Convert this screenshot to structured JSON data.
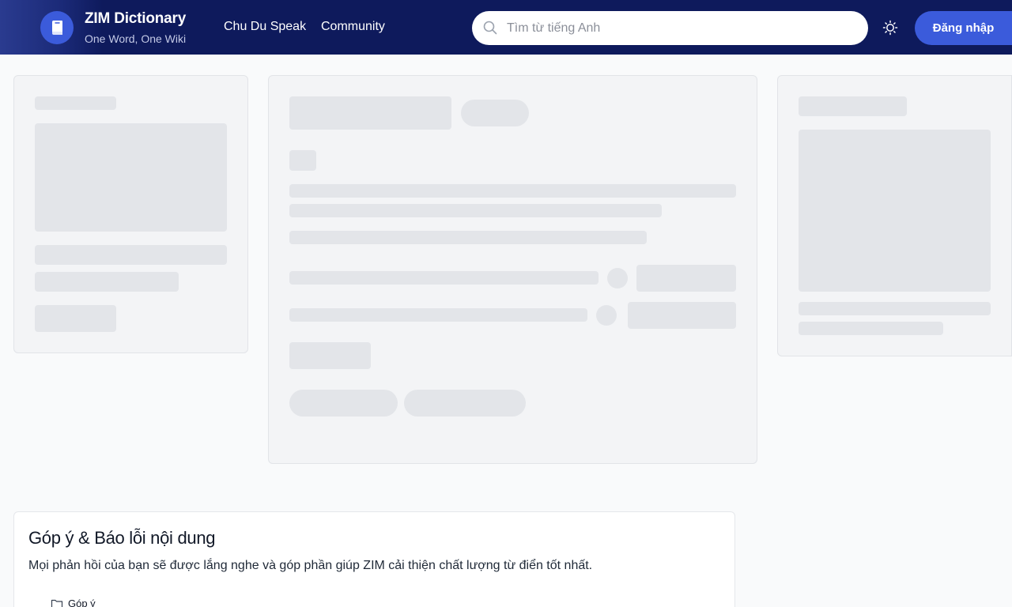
{
  "header": {
    "brand_title": "ZIM Dictionary",
    "brand_subtitle": "One Word, One Wiki",
    "nav": [
      {
        "label": "Chu Du Speak"
      },
      {
        "label": "Community"
      }
    ],
    "search": {
      "placeholder": "Tìm từ tiếng Anh",
      "value": ""
    },
    "login_label": "Đăng nhập",
    "icons": {
      "logo": "book-icon",
      "search": "search-icon",
      "theme": "sun-icon"
    }
  },
  "feedback": {
    "title": "Góp ý & Báo lỗi nội dung",
    "description": "Mọi phản hồi của bạn sẽ được lắng nghe và góp phần giúp ZIM cải thiện chất lượng từ điển tốt nhất.",
    "tab_label": "Góp ý",
    "tab_icon": "folder-icon"
  },
  "colors": {
    "header_bg": "#0e1a5c",
    "accent": "#3b5bdb",
    "skeleton": "#e3e5e9",
    "card_bg": "#f3f4f6"
  }
}
